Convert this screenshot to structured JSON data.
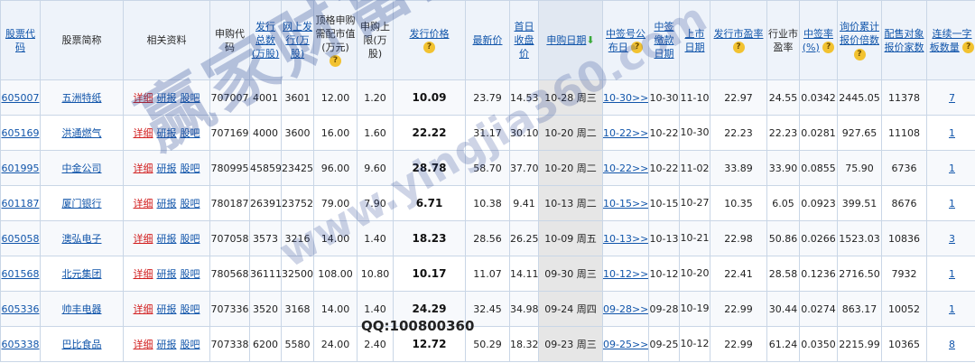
{
  "headers": {
    "code": "股票代码",
    "name": "股票简称",
    "info": "相关资料",
    "purchase_code": "申购代码",
    "total_shares": "发行总数(万股)",
    "online_shares": "网上发行(万股)",
    "top_market_value": "顶格申购需配市值(万元)",
    "purchase_limit": "申购上限(万股)",
    "issue_price": "发行价格",
    "latest_price": "最新价",
    "first_close": "首日收盘价",
    "purchase_date": "申购日期",
    "lottery_date": "中签号公布日",
    "payment_date": "中签缴款日期",
    "listing_date": "上市日期",
    "issue_pe": "发行市盈率",
    "industry_pe": "行业市盈率",
    "lottery_rate": "中签率(%)",
    "inquiry_multiple": "询价累计报价倍数",
    "placement_count": "配售对象报价家数",
    "limit_up_count": "连续一字板数量"
  },
  "icons": {
    "help": "?",
    "sort_down": "⬇"
  },
  "rows": [
    {
      "code": "605007",
      "name": "五洲特纸",
      "detail": "详细",
      "research": "研报",
      "forum": "股吧",
      "purchase_code": "707007",
      "total_shares": "4001",
      "online_shares": "3601",
      "top_market_value": "12.00",
      "purchase_limit": "1.20",
      "issue_price": "10.09",
      "latest_price": "23.79",
      "first_close": "14.53",
      "purchase_date": "10-28 周三",
      "lottery_date": "10-30>>",
      "payment_date": "10-30",
      "listing_date": "11-10",
      "issue_pe": "22.97",
      "industry_pe": "24.55",
      "lottery_rate": "0.0342",
      "inquiry_multiple": "2445.05",
      "placement_count": "11378",
      "limit_up_count": "7"
    },
    {
      "code": "605169",
      "name": "洪通燃气",
      "detail": "详细",
      "research": "研报",
      "forum": "股吧",
      "purchase_code": "707169",
      "total_shares": "4000",
      "online_shares": "3600",
      "top_market_value": "16.00",
      "purchase_limit": "1.60",
      "issue_price": "22.22",
      "latest_price": "31.17",
      "first_close": "30.10",
      "purchase_date": "10-20 周二",
      "lottery_date": "10-22>>",
      "payment_date": "10-22",
      "listing_date": "10-30",
      "issue_pe": "22.23",
      "industry_pe": "22.23",
      "lottery_rate": "0.0281",
      "inquiry_multiple": "927.65",
      "placement_count": "11108",
      "limit_up_count": "1"
    },
    {
      "code": "601995",
      "name": "中金公司",
      "detail": "详细",
      "research": "研报",
      "forum": "股吧",
      "purchase_code": "780995",
      "total_shares": "45859",
      "online_shares": "23425",
      "top_market_value": "96.00",
      "purchase_limit": "9.60",
      "issue_price": "28.78",
      "latest_price": "58.70",
      "first_close": "37.70",
      "purchase_date": "10-20 周二",
      "lottery_date": "10-22>>",
      "payment_date": "10-22",
      "listing_date": "11-02",
      "issue_pe": "33.89",
      "industry_pe": "33.90",
      "lottery_rate": "0.0855",
      "inquiry_multiple": "75.90",
      "placement_count": "6736",
      "limit_up_count": "1"
    },
    {
      "code": "601187",
      "name": "厦门银行",
      "detail": "详细",
      "research": "研报",
      "forum": "股吧",
      "purchase_code": "780187",
      "total_shares": "26391",
      "online_shares": "23752",
      "top_market_value": "79.00",
      "purchase_limit": "7.90",
      "issue_price": "6.71",
      "latest_price": "10.38",
      "first_close": "9.41",
      "purchase_date": "10-13 周二",
      "lottery_date": "10-15>>",
      "payment_date": "10-15",
      "listing_date": "10-27",
      "issue_pe": "10.35",
      "industry_pe": "6.05",
      "lottery_rate": "0.0923",
      "inquiry_multiple": "399.51",
      "placement_count": "8676",
      "limit_up_count": "1"
    },
    {
      "code": "605058",
      "name": "澳弘电子",
      "detail": "详细",
      "research": "研报",
      "forum": "股吧",
      "purchase_code": "707058",
      "total_shares": "3573",
      "online_shares": "3216",
      "top_market_value": "14.00",
      "purchase_limit": "1.40",
      "issue_price": "18.23",
      "latest_price": "28.56",
      "first_close": "26.25",
      "purchase_date": "10-09 周五",
      "lottery_date": "10-13>>",
      "payment_date": "10-13",
      "listing_date": "10-21",
      "issue_pe": "22.98",
      "industry_pe": "50.86",
      "lottery_rate": "0.0266",
      "inquiry_multiple": "1523.03",
      "placement_count": "10836",
      "limit_up_count": "3"
    },
    {
      "code": "601568",
      "name": "北元集团",
      "detail": "详细",
      "research": "研报",
      "forum": "股吧",
      "purchase_code": "780568",
      "total_shares": "36111",
      "online_shares": "32500",
      "top_market_value": "108.00",
      "purchase_limit": "10.80",
      "issue_price": "10.17",
      "latest_price": "11.07",
      "first_close": "14.11",
      "purchase_date": "09-30 周三",
      "lottery_date": "10-12>>",
      "payment_date": "10-12",
      "listing_date": "10-20",
      "issue_pe": "22.41",
      "industry_pe": "28.58",
      "lottery_rate": "0.1236",
      "inquiry_multiple": "2716.50",
      "placement_count": "7932",
      "limit_up_count": "1"
    },
    {
      "code": "605336",
      "name": "帅丰电器",
      "detail": "详细",
      "research": "研报",
      "forum": "股吧",
      "purchase_code": "707336",
      "total_shares": "3520",
      "online_shares": "3168",
      "top_market_value": "14.00",
      "purchase_limit": "1.40",
      "issue_price": "24.29",
      "latest_price": "32.45",
      "first_close": "34.98",
      "purchase_date": "09-24 周四",
      "lottery_date": "09-28>>",
      "payment_date": "09-28",
      "listing_date": "10-19",
      "issue_pe": "22.99",
      "industry_pe": "30.44",
      "lottery_rate": "0.0274",
      "inquiry_multiple": "863.17",
      "placement_count": "10052",
      "limit_up_count": "1"
    },
    {
      "code": "605338",
      "name": "巴比食品",
      "detail": "详细",
      "research": "研报",
      "forum": "股吧",
      "purchase_code": "707338",
      "total_shares": "6200",
      "online_shares": "5580",
      "top_market_value": "24.00",
      "purchase_limit": "2.40",
      "issue_price": "12.72",
      "latest_price": "50.29",
      "first_close": "18.32",
      "purchase_date": "09-23 周三",
      "lottery_date": "09-25>>",
      "payment_date": "09-25",
      "listing_date": "10-12",
      "issue_pe": "22.99",
      "industry_pe": "61.24",
      "lottery_rate": "0.0350",
      "inquiry_multiple": "2215.99",
      "placement_count": "10365",
      "limit_up_count": "8"
    }
  ],
  "watermark": {
    "main": "赢家财富网",
    "sub": "www.yingjia360.com",
    "qq": "QQ:100800360"
  }
}
